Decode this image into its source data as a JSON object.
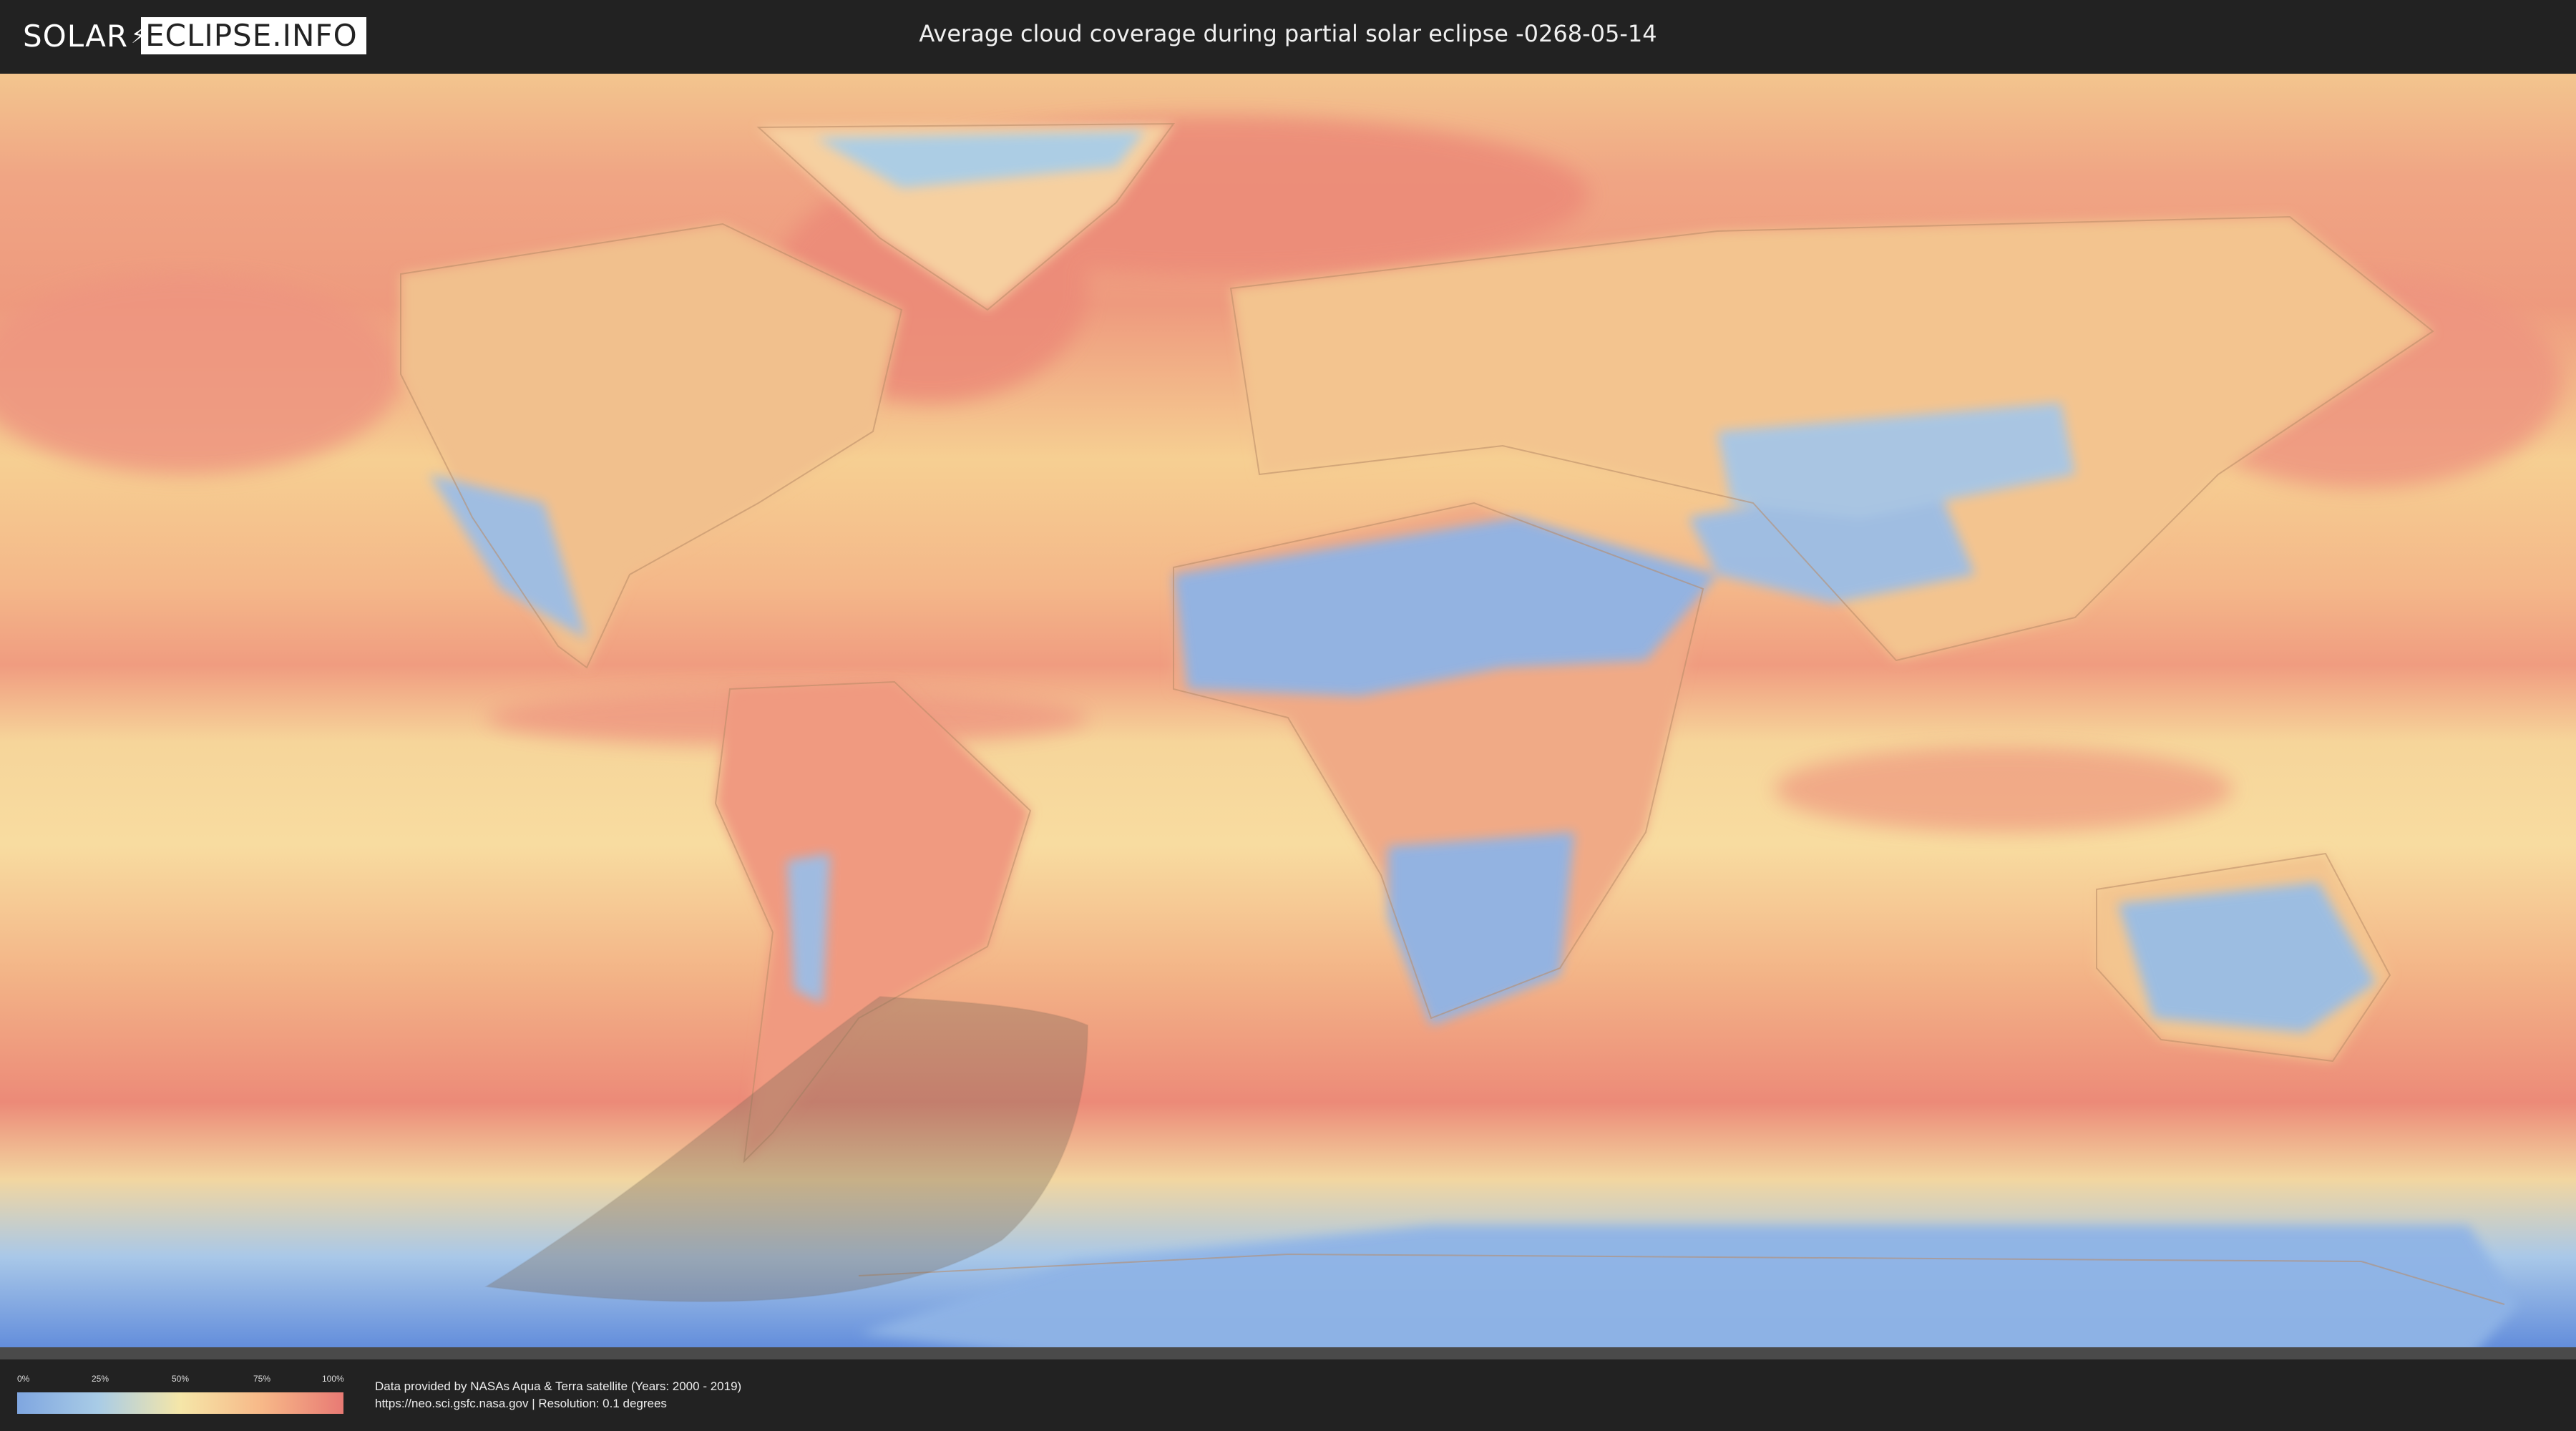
{
  "logo": {
    "text_left": "SOLAR",
    "text_right": "ECLIPSE.INFO"
  },
  "title": "Average cloud coverage during partial solar eclipse -0268-05-14",
  "legend": {
    "ticks": [
      "0%",
      "25%",
      "50%",
      "75%",
      "100%"
    ],
    "colors": [
      "#7fa6e0",
      "#a9cce6",
      "#f5e6a8",
      "#f7b888",
      "#e87a74"
    ]
  },
  "credits": {
    "line1": "Data provided by NASAs Aqua & Terra satellite (Years: 2000 - 2019)",
    "line2": "https://neo.sci.gsfc.nasa.gov | Resolution: 0.1 degrees"
  },
  "map": {
    "projection": "equirectangular",
    "layer": "average cloud coverage",
    "overlay": "partial eclipse visibility area",
    "overlay_color": "#7a6a5a"
  }
}
